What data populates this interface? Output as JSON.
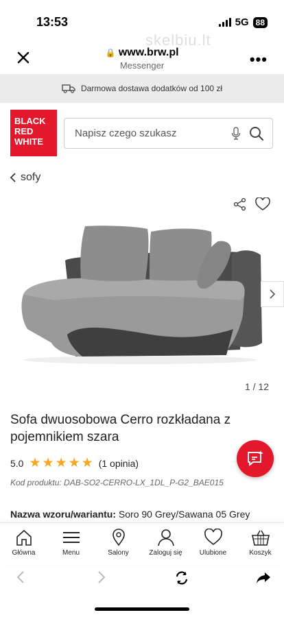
{
  "status_bar": {
    "time": "13:53",
    "network": "5G",
    "battery": "88"
  },
  "browser": {
    "url": "www.brw.pl",
    "source": "Messenger",
    "watermark": "skelbiu.lt"
  },
  "promo": {
    "text": "Darmowa dostawa dodatków od 100 zł"
  },
  "logo": {
    "line1": "BLACK",
    "line2": "RED",
    "line3": "WHITE"
  },
  "search": {
    "placeholder": "Napisz czego szukasz"
  },
  "breadcrumb": {
    "label": "sofy"
  },
  "gallery": {
    "counter": "1 / 12"
  },
  "product": {
    "title": "Sofa dwuosobowa Cerro rozkładana z pojemnikiem szara",
    "rating": "5.0",
    "stars": 5,
    "reviews": "(1 opinia)",
    "code": "Kod produktu: DAB-SO2-CERRO-LX_1DL_P-G2_BAE015",
    "variant_label": "Nazwa wzoru/wariantu:",
    "variant_value": "Soro 90 Grey/Sawana 05 Grey"
  },
  "bottom_nav": {
    "items": [
      {
        "label": "Główna",
        "icon": "home-icon"
      },
      {
        "label": "Menu",
        "icon": "menu-icon"
      },
      {
        "label": "Salony",
        "icon": "location-icon"
      },
      {
        "label": "Zaloguj się",
        "icon": "user-icon"
      },
      {
        "label": "Ulubione",
        "icon": "heart-icon"
      },
      {
        "label": "Koszyk",
        "icon": "basket-icon"
      }
    ]
  },
  "colors": {
    "brand_red": "#e3182d",
    "star": "#f5a623",
    "promo_bg": "#ececec"
  }
}
